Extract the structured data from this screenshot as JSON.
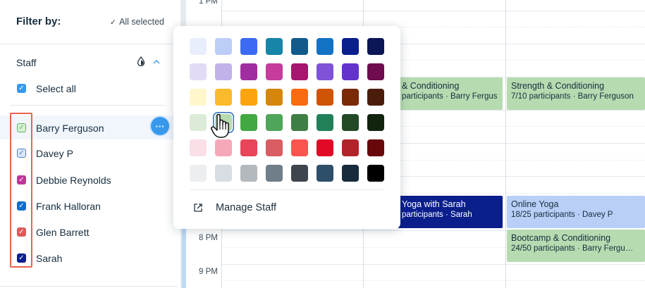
{
  "sidebar": {
    "filter_title": "Filter by:",
    "all_selected": "All selected",
    "staff_header": "Staff",
    "select_all": "Select all",
    "staff": [
      {
        "name": "Barry Ferguson",
        "color": "#5cb85c",
        "style": "outlined"
      },
      {
        "name": "Davey P",
        "color": "#4a7fd4",
        "style": "outlined"
      },
      {
        "name": "Debbie Reynolds",
        "color": "#c0349b",
        "style": "filled"
      },
      {
        "name": "Frank Halloran",
        "color": "#116dcc",
        "style": "filled"
      },
      {
        "name": "Glen Barrett",
        "color": "#dd5a5a",
        "style": "filled"
      },
      {
        "name": "Sarah",
        "color": "#0a1e8c",
        "style": "filled"
      }
    ],
    "more_label": "···"
  },
  "calendar": {
    "times": [
      "1 PM",
      "8 PM",
      "9 PM"
    ],
    "events": [
      {
        "title": "& Conditioning",
        "sub": "participants · Barry Fergus",
        "color": "green"
      },
      {
        "title": "Strength & Conditioning",
        "sub": "7/10 participants · Barry Ferguson",
        "color": "green"
      },
      {
        "title": "Yoga with Sarah",
        "sub": "participants · Sarah",
        "color": "navy"
      },
      {
        "title": "Online Yoga",
        "sub": "18/25 participants · Davey P",
        "color": "lblue"
      },
      {
        "title": "Bootcamp & Conditioning",
        "sub": "24/50 participants · Barry Fergu…",
        "color": "green"
      }
    ]
  },
  "color_picker": {
    "rows": [
      [
        "#e9eefc",
        "#bccdf8",
        "#3a6bf2",
        "#1685a8",
        "#125a8c",
        "#1472c4",
        "#0a1e8c",
        "#0a1656"
      ],
      [
        "#e2dbf5",
        "#c2b2ea",
        "#a02ea0",
        "#c63b9c",
        "#a6156e",
        "#7f52d6",
        "#6333cc",
        "#6e0c4f"
      ],
      [
        "#fff6cc",
        "#fbba2b",
        "#fba40f",
        "#d4870a",
        "#fa6a11",
        "#cf5504",
        "#7a2a06",
        "#4a1d0a"
      ],
      [
        "#dcebd7",
        "#b7dbb0",
        "#42a842",
        "#4fa55a",
        "#3f7e45",
        "#218058",
        "#234a25",
        "#12240e"
      ],
      [
        "#fbdfe6",
        "#f5a9b8",
        "#e8445a",
        "#d85c62",
        "#fb5550",
        "#e10926",
        "#b1242a",
        "#68080b"
      ],
      [
        "#eceef0",
        "#d7dde3",
        "#b4b9be",
        "#6f7e89",
        "#3f454c",
        "#2e4f6a",
        "#182b3c",
        "#000000"
      ]
    ],
    "selected": {
      "row": 3,
      "col": 1
    },
    "manage_label": "Manage Staff"
  }
}
